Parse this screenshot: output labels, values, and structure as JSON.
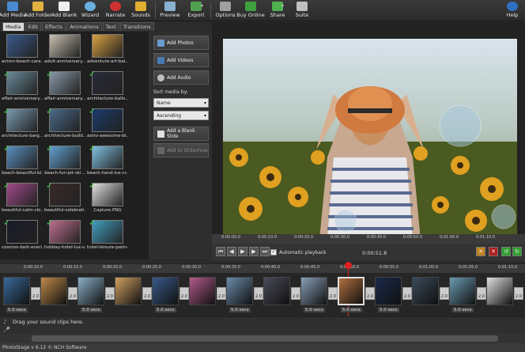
{
  "toolbar": {
    "add_media": "Add Media",
    "add_folder": "Add Folder",
    "add_blank": "Add Blank",
    "wizard": "Wizard",
    "narrate": "Narrate",
    "sounds": "Sounds",
    "preview": "Preview",
    "export": "Export",
    "options": "Options",
    "buy_online": "Buy Online",
    "share": "Share",
    "suite": "Suite",
    "help": "Help"
  },
  "tabs": [
    "Media",
    "Edit",
    "Effects",
    "Animations",
    "Text",
    "Transitions"
  ],
  "media": [
    {
      "name": "action-beach-care...",
      "checked": false,
      "color": "#3a5a8c"
    },
    {
      "name": "adult-anniversary...",
      "checked": false,
      "color": "#c8c0b0"
    },
    {
      "name": "adventure-art-bal...",
      "checked": false,
      "color": "#d8a040"
    },
    {
      "name": "affair-anniversary...",
      "checked": true,
      "color": "#6a8a9a"
    },
    {
      "name": "affair-anniversary...",
      "checked": true,
      "color": "#8a9aaa"
    },
    {
      "name": "architecture-ballo...",
      "checked": true,
      "color": "#2a2a3a"
    },
    {
      "name": "architecture-barg...",
      "checked": true,
      "color": "#7a9ab0"
    },
    {
      "name": "architecture-build...",
      "checked": true,
      "color": "#4a6a8a"
    },
    {
      "name": "astro-awesome-bl...",
      "checked": true,
      "color": "#1a3a6a"
    },
    {
      "name": "beach-beautiful-bl...",
      "checked": true,
      "color": "#5a90c0"
    },
    {
      "name": "beach-fun-jet-ski...",
      "checked": true,
      "color": "#60a0d0"
    },
    {
      "name": "beach-hand-ice-cr...",
      "checked": true,
      "color": "#80c0e0"
    },
    {
      "name": "beautiful-calm-clo...",
      "checked": true,
      "color": "#a04a8a"
    },
    {
      "name": "beautiful-celebrati...",
      "checked": true,
      "color": "#3a2a2a"
    },
    {
      "name": "Capture.PNG",
      "checked": true,
      "color": "#e0e0e0"
    },
    {
      "name": "cosmos-dark-everi...",
      "checked": true,
      "color": "#1a1a2a"
    },
    {
      "name": "holiday-hotel-lux-v...",
      "checked": true,
      "color": "#c07090"
    },
    {
      "name": "hotel-leisure-palm-...",
      "checked": true,
      "color": "#40a0c0"
    }
  ],
  "side": {
    "add_photos": "Add Photos",
    "add_videos": "Add Videos",
    "add_audio": "Add Audio",
    "sort_label": "Sort media by:",
    "sort_value": "Name",
    "order_value": "Ascending",
    "add_blank_slide": "Add a Blank Slide",
    "add_to_slideshow": "Add to Slideshow"
  },
  "preview_ruler": [
    "0:00:00.0",
    "0:00:10.0",
    "0:00:20.0",
    "0:00:30.0",
    "0:00:40.0",
    "0:00:50.0",
    "0:01:00.0",
    "0:01:10.0"
  ],
  "controls": {
    "autoplay": "Automatic playback",
    "time": "0:00:51.8"
  },
  "timeline_ruler": [
    "0:00:10.0",
    "0:00:15.0",
    "0:00:20.0",
    "0:00:25.0",
    "0:00:30.0",
    "0:00:35.0",
    "0:00:40.0",
    "0:00:45.0",
    "0:00:50.0",
    "0:00:55.0",
    "0:01:00.0",
    "0:01:05.0",
    "0:01:10.0"
  ],
  "clips": [
    "#3a6a9a",
    "#c08a4a",
    "#8ab0c8",
    "#d0a060",
    "#3a5a8a",
    "#b05a8a",
    "#6a8aaa",
    "#4a4a5a",
    "#8aa0b8",
    "#b07040",
    "#1a2a4a",
    "#3a4a5a",
    "#6a9ab0",
    "#e0e0e0"
  ],
  "clip_duration": "5.0 secs",
  "transition_value": "2.0",
  "sound_hint": "Drag your sound clips here.",
  "status": "PhotoStage v 6.12 © NCH Software"
}
